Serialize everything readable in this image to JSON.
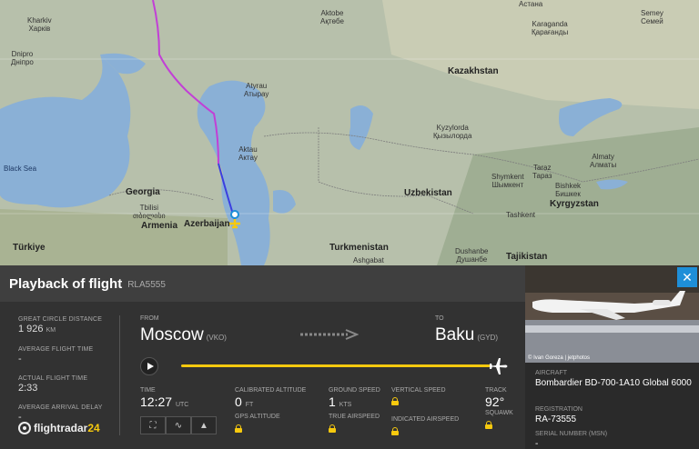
{
  "map": {
    "labels": {
      "kharkiv": "Kharkiv\nХарків",
      "dnipro": "Dnipro\nДніпро",
      "black_sea": "Black Sea",
      "georgia": "Georgia",
      "tbilisi": "Tbilisi\nთბილისი",
      "armenia": "Armenia",
      "azerbaijan": "Azerbaijan",
      "turkiye": "Türkiye",
      "atyrau": "Atyrau\nАтырау",
      "aktau": "Aktau\nАктау",
      "kazakhstan": "Kazakhstan",
      "aktobe": "Aktobe\nАқтөбе",
      "astana": "Астана",
      "karaganda": "Karaganda\nҚарағанды",
      "semey": "Semey\nСемей",
      "kyzylorda": "Kyzylorda\nҚызылорда",
      "taraz": "Taraz\nТараз",
      "almaty": "Almaty\nАлматы",
      "shymkent": "Shymkent\nШымкент",
      "bishkek": "Bishkek\nБишкек",
      "uzbekistan": "Uzbekistan",
      "tashkent": "Tashkent",
      "kyrgyzstan": "Kyrgyzstan",
      "turkmenistan": "Turkmenistan",
      "ashgabat": "Ashgabat",
      "dushanbe": "Dushanbe\nДушанбе",
      "tajikistan": "Tajikistan"
    }
  },
  "panel": {
    "title": "Playback of flight",
    "flight_number": "RLA5555",
    "stats": {
      "great_circle_label": "GREAT CIRCLE DISTANCE",
      "great_circle_value": "1 926",
      "great_circle_unit": "KM",
      "avg_flight_time_label": "AVERAGE FLIGHT TIME",
      "avg_flight_time_value": "-",
      "actual_flight_time_label": "ACTUAL FLIGHT TIME",
      "actual_flight_time_value": "2:33",
      "avg_arrival_delay_label": "AVERAGE ARRIVAL DELAY",
      "avg_arrival_delay_value": "-"
    },
    "logo_text": "flightradar",
    "logo_num": "24",
    "from_label": "FROM",
    "from_city": "Moscow",
    "from_code": "(VKO)",
    "to_label": "TO",
    "to_city": "Baku",
    "to_code": "(GYD)",
    "playback_progress": 1.0,
    "fields": {
      "time_label": "TIME",
      "time_value": "12:27",
      "time_unit": "UTC",
      "cal_alt_label": "CALIBRATED ALTITUDE",
      "cal_alt_value": "0",
      "cal_alt_unit": "FT",
      "gps_alt_label": "GPS ALTITUDE",
      "ground_speed_label": "GROUND SPEED",
      "ground_speed_value": "1",
      "ground_speed_unit": "KTS",
      "true_airspeed_label": "TRUE AIRSPEED",
      "vertical_speed_label": "VERTICAL SPEED",
      "indicated_airspeed_label": "INDICATED AIRSPEED",
      "track_label": "TRACK",
      "track_value": "92°",
      "squawk_label": "SQUAWK"
    }
  },
  "aircraft": {
    "photo_credit": "© Ivan Goreza | jetphotos",
    "aircraft_label": "AIRCRAFT",
    "aircraft_value": "Bombardier BD-700-1A10 Global 6000",
    "registration_label": "REGISTRATION",
    "registration_value": "RA-73555",
    "serial_label": "SERIAL NUMBER (MSN)",
    "serial_value": "-"
  },
  "colors": {
    "accent": "#f6c90e",
    "route_purple": "#c23fd6",
    "route_blue": "#3b3fe0",
    "close_blue": "#1e8fd8"
  }
}
